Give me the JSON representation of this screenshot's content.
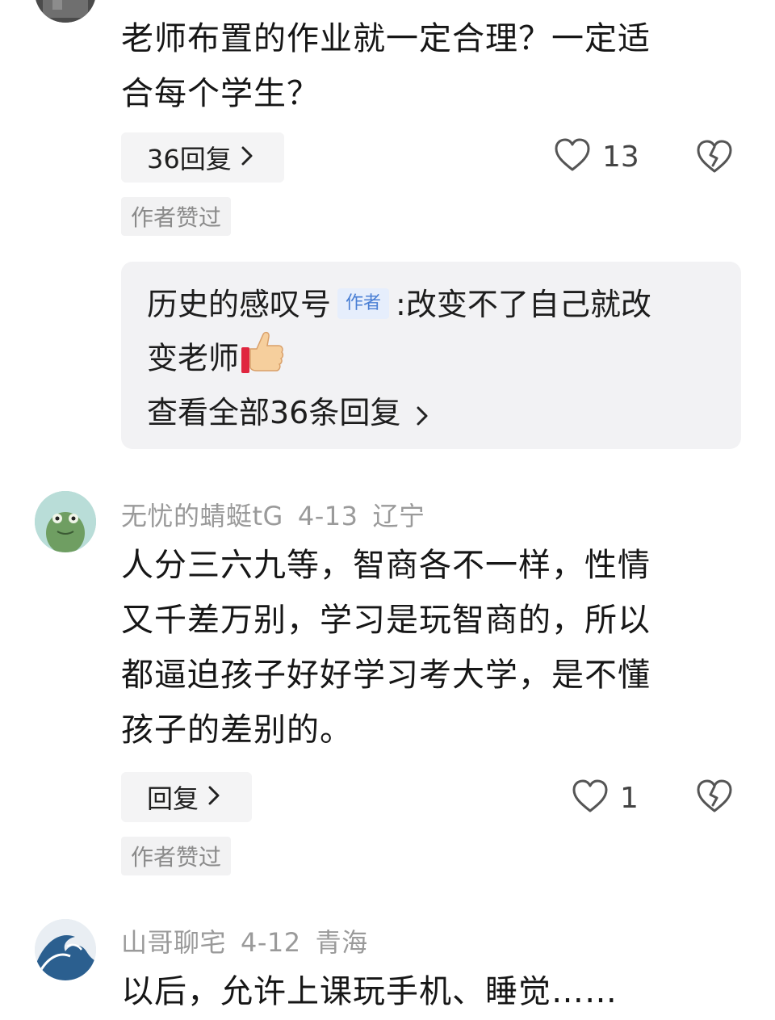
{
  "comments": [
    {
      "text_lines": [
        "老师布置的作业就一定合理？一定适",
        "合每个学生？"
      ],
      "reply_button": "36回复",
      "like_count": "13",
      "author_liked": "作者赞过",
      "reply_preview": {
        "username": "历史的感叹号",
        "author_tag": "作者",
        "separator": ":",
        "text_line1": "改变不了自己就改",
        "text_line2": "变老师",
        "emoji": "👍",
        "view_all": "查看全部36条回复"
      }
    },
    {
      "username": "无忧的蜻蜓tG",
      "date": "4-13",
      "location": "辽宁",
      "text_lines": [
        "人分三六九等，智商各不一样，性情",
        "又千差万别，学习是玩智商的，所以",
        "都逼迫孩子好好学习考大学，是不懂",
        "孩子的差别的。"
      ],
      "reply_button": "回复",
      "like_count": "1",
      "author_liked": "作者赞过"
    },
    {
      "username": "山哥聊宅",
      "date": "4-12",
      "location": "青海",
      "text_lines": [
        "以后，允许上课玩手机、睡觉……"
      ]
    }
  ],
  "icons": {
    "chevron": "chevron-right-icon",
    "like": "heart-icon",
    "dislike": "broken-heart-icon"
  },
  "colors": {
    "author_tag_bg": "#e6eefc",
    "author_tag_text": "#4a7fd4",
    "meta_text": "#9a9a9a"
  }
}
